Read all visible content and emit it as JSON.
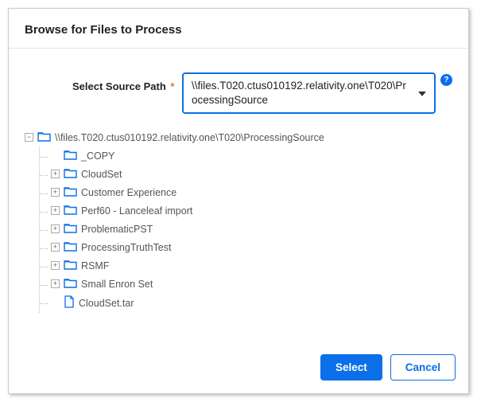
{
  "dialog": {
    "title": "Browse for Files to Process"
  },
  "form": {
    "source_path_label": "Select Source Path",
    "required_mark": "*",
    "source_path_value": "\\\\files.T020.ctus010192.relativity.one\\T020\\ProcessingSource",
    "help_symbol": "?"
  },
  "tree": {
    "root": {
      "label": "\\\\files.T020.ctus010192.relativity.one\\T020\\ProcessingSource",
      "icon": "folder",
      "expanded": true
    },
    "children": [
      {
        "label": "_COPY",
        "icon": "folder",
        "expander": "none"
      },
      {
        "label": "CloudSet",
        "icon": "folder",
        "expander": "plus"
      },
      {
        "label": "Customer Experience",
        "icon": "folder",
        "expander": "plus"
      },
      {
        "label": "Perf60 - Lanceleaf import",
        "icon": "folder",
        "expander": "plus"
      },
      {
        "label": "ProblematicPST",
        "icon": "folder",
        "expander": "plus"
      },
      {
        "label": "ProcessingTruthTest",
        "icon": "folder",
        "expander": "plus"
      },
      {
        "label": "RSMF",
        "icon": "folder",
        "expander": "plus"
      },
      {
        "label": "Small Enron Set",
        "icon": "folder",
        "expander": "plus"
      },
      {
        "label": "CloudSet.tar",
        "icon": "file",
        "expander": "none"
      }
    ]
  },
  "footer": {
    "select_label": "Select",
    "cancel_label": "Cancel"
  },
  "glyphs": {
    "plus": "+",
    "minus": "−"
  },
  "colors": {
    "accent": "#0a6fe8"
  }
}
